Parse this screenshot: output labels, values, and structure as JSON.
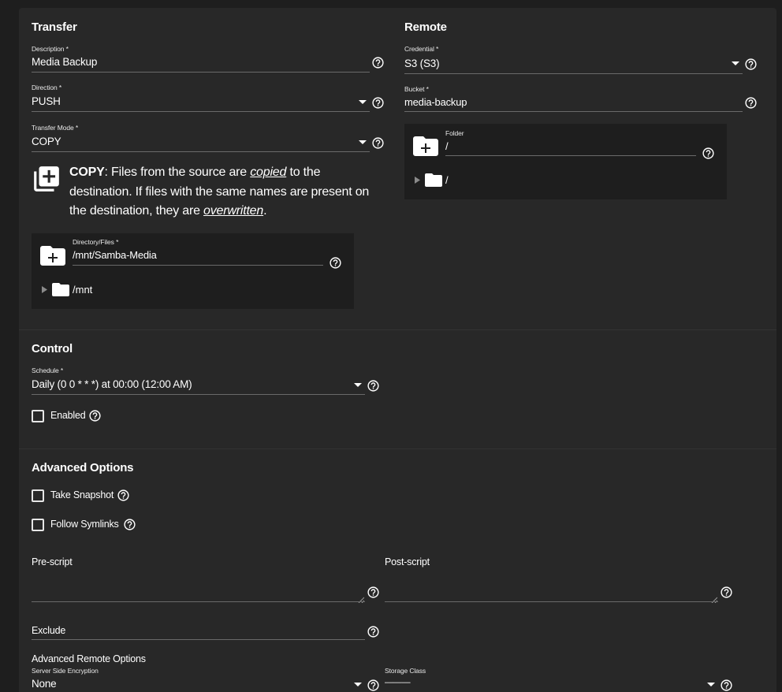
{
  "transfer": {
    "heading": "Transfer",
    "description": {
      "label": "Description *",
      "value": "Media Backup"
    },
    "direction": {
      "label": "Direction *",
      "value": "PUSH"
    },
    "transfer_mode": {
      "label": "Transfer Mode *",
      "value": "COPY"
    },
    "mode_description": {
      "mode": "COPY",
      "text1": ": Files from the source are ",
      "em1": "copied",
      "text2": " to the destination. If files with the same names are present on the destination, they are ",
      "em2": "overwritten",
      "text3": "."
    },
    "directory": {
      "label": "Directory/Files *",
      "value": "/mnt/Samba-Media",
      "tree_node": "/mnt"
    }
  },
  "remote": {
    "heading": "Remote",
    "credential": {
      "label": "Credential *",
      "value": "S3 (S3)"
    },
    "bucket": {
      "label": "Bucket *",
      "value": "media-backup"
    },
    "folder": {
      "label": "Folder",
      "value": "/",
      "tree_node": "/"
    }
  },
  "control": {
    "heading": "Control",
    "schedule": {
      "label": "Schedule *",
      "value": "Daily (0 0 * * *) at 00:00 (12:00 AM)"
    },
    "enabled": {
      "label": "Enabled",
      "checked": false
    }
  },
  "advanced": {
    "heading": "Advanced Options",
    "take_snapshot": {
      "label": "Take Snapshot",
      "checked": false
    },
    "follow_symlinks": {
      "label": "Follow Symlinks",
      "checked": false
    },
    "pre_script": {
      "label": "Pre-script",
      "value": ""
    },
    "post_script": {
      "label": "Post-script",
      "value": ""
    },
    "exclude": {
      "label": "Exclude",
      "value": ""
    },
    "remote_options_heading": "Advanced Remote Options",
    "server_side_encryption": {
      "label": "Server Side Encryption",
      "value": "None"
    },
    "storage_class": {
      "label": "Storage Class",
      "value": "———"
    }
  },
  "colors": {
    "background": "#1e1e1e",
    "card": "#282828",
    "text": "#ffffff",
    "underline": "#6a6a6a"
  },
  "icons": [
    "help-circle-icon",
    "dropdown-caret-icon",
    "library-add-icon",
    "create-folder-icon",
    "folder-icon",
    "expand-triangle-icon",
    "checkbox-icon",
    "textarea-resize-icon"
  ]
}
